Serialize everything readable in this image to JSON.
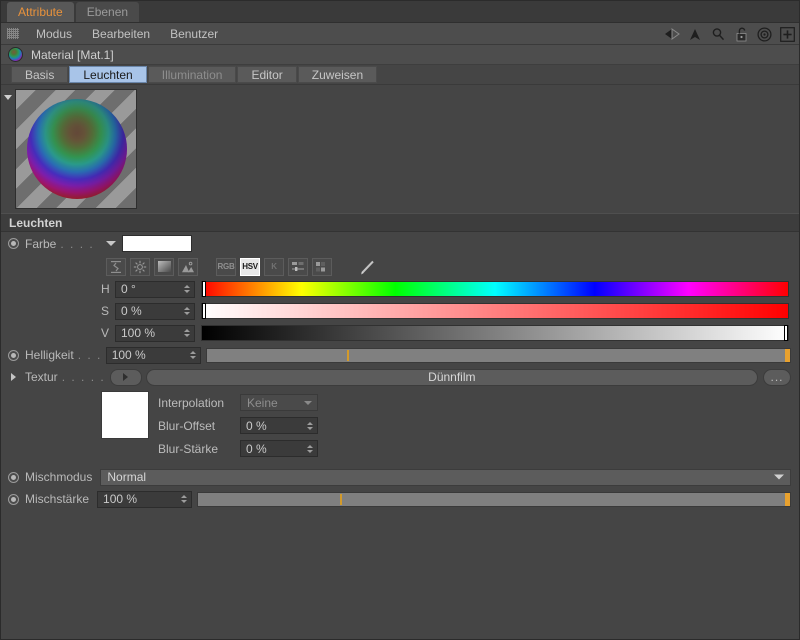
{
  "window_tabs": [
    {
      "label": "Attribute",
      "active": true
    },
    {
      "label": "Ebenen",
      "active": false
    }
  ],
  "menubar": {
    "grip_icon": "grip-dots-icon",
    "items": [
      "Modus",
      "Bearbeiten",
      "Benutzer"
    ],
    "icons": [
      "back-arrow-icon",
      "forward-arrow-icon",
      "up-arrow-icon",
      "search-icon",
      "lock-open-icon",
      "target-icon",
      "plus-icon"
    ]
  },
  "object_header": {
    "icon": "material-ball-icon",
    "title": "Material [Mat.1]"
  },
  "property_tabs": [
    {
      "label": "Basis",
      "state": "normal"
    },
    {
      "label": "Leuchten",
      "state": "selected"
    },
    {
      "label": "Illumination",
      "state": "dim"
    },
    {
      "label": "Editor",
      "state": "normal"
    },
    {
      "label": "Zuweisen",
      "state": "normal"
    }
  ],
  "preview": {
    "collapse_icon": "triangle-down-icon",
    "thumbnail": "material-sphere-preview"
  },
  "section": {
    "title": "Leuchten"
  },
  "color": {
    "label": "Farbe",
    "leader": ". . . .",
    "swatch_hex": "#ffffff",
    "mode_buttons": [
      {
        "name": "sampler-icon",
        "text": "",
        "state": "normal"
      },
      {
        "name": "color-wheel-icon",
        "text": "",
        "state": "normal"
      },
      {
        "name": "gradient-icon",
        "text": "",
        "state": "normal"
      },
      {
        "name": "image-icon",
        "text": "",
        "state": "normal"
      },
      {
        "name": "rgb-mode-button",
        "text": "RGB",
        "state": "normal"
      },
      {
        "name": "hsv-mode-button",
        "text": "HSV",
        "state": "selected"
      },
      {
        "name": "k-mode-button",
        "text": "K",
        "state": "dim"
      },
      {
        "name": "sliders-icon",
        "text": "",
        "state": "normal"
      },
      {
        "name": "swatches-icon",
        "text": "",
        "state": "normal"
      },
      {
        "name": "eyedropper-icon",
        "text": "",
        "state": "normal"
      }
    ],
    "channels": [
      {
        "key": "H",
        "value": "0 °",
        "knob_pct": 0
      },
      {
        "key": "S",
        "value": "0 %",
        "knob_pct": 0
      },
      {
        "key": "V",
        "value": "100 %",
        "knob_pct": 100
      }
    ]
  },
  "brightness": {
    "label": "Helligkeit",
    "leader": ". . .",
    "value": "100 %",
    "tick_pct": 24,
    "knob_pct": 100
  },
  "texture": {
    "label": "Textur",
    "leader": ". . . . . . .",
    "expand_icon": "triangle-right-icon",
    "play_icon": "triangle-right-icon",
    "value": "Dünnfilm",
    "more_button": "...",
    "thumbnail": "texture-thumbnail",
    "fields": [
      {
        "label": "Interpolation",
        "value": "Keine",
        "type": "select",
        "disabled": true
      },
      {
        "label": "Blur-Offset",
        "value": "0 %",
        "type": "number",
        "disabled": false
      },
      {
        "label": "Blur-Stärke",
        "value": "0 %",
        "type": "number",
        "disabled": false
      }
    ]
  },
  "mix_mode": {
    "label": "Mischmodus",
    "value": "Normal"
  },
  "mix_strength": {
    "label": "Mischstärke",
    "value": "100 %",
    "tick_pct": 24,
    "knob_pct": 100
  },
  "theme": {
    "accent_selected_tab": "#a8c4e8",
    "accent_active_text": "#e8923c",
    "slider_knob": "#e8a12e",
    "background": "#454545"
  }
}
